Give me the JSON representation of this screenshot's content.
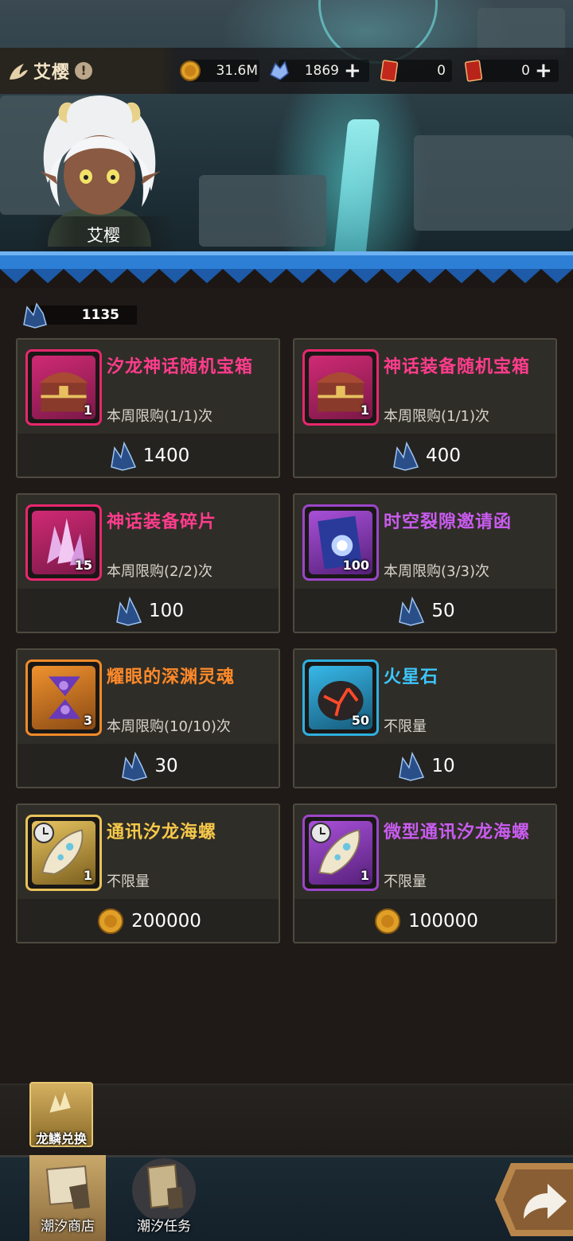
{
  "topbar": {
    "title": "艾樱",
    "info_icon": "exclamation-icon",
    "currencies": [
      {
        "name": "gold-coin-icon",
        "value": "31.6M",
        "has_plus": false
      },
      {
        "name": "crystal-icon",
        "value": "1869",
        "has_plus": true
      },
      {
        "name": "red-card-icon",
        "value": "0",
        "has_plus": false
      },
      {
        "name": "red-ticket-icon",
        "value": "0",
        "has_plus": true
      }
    ],
    "plus_label": "+"
  },
  "character": {
    "name": "艾樱"
  },
  "balance": {
    "value": "1135",
    "icon": "dragon-scale-icon"
  },
  "items": [
    {
      "name": "汐龙神话随机宝箱",
      "limit": "本周限购(1/1)次",
      "qty": "1",
      "price": "1400",
      "price_icon": "dragon-scale-icon",
      "name_color": "#ff3c8c",
      "frame": "#e8276e",
      "icon": "treasure-chest-icon",
      "timed": false
    },
    {
      "name": "神话装备随机宝箱",
      "limit": "本周限购(1/1)次",
      "qty": "1",
      "price": "400",
      "price_icon": "dragon-scale-icon",
      "name_color": "#ff3c8c",
      "frame": "#e8276e",
      "icon": "treasure-chest-icon",
      "timed": false
    },
    {
      "name": "神话装备碎片",
      "limit": "本周限购(2/2)次",
      "qty": "15",
      "price": "100",
      "price_icon": "dragon-scale-icon",
      "name_color": "#ff3c8c",
      "frame": "#e8276e",
      "icon": "crystal-shard-icon",
      "timed": false
    },
    {
      "name": "时空裂隙邀请函",
      "limit": "本周限购(3/3)次",
      "qty": "100",
      "price": "50",
      "price_icon": "dragon-scale-icon",
      "name_color": "#c95cf0",
      "frame": "#9b46c8",
      "icon": "invitation-scroll-icon",
      "timed": false
    },
    {
      "name": "耀眼的深渊灵魂",
      "limit": "本周限购(10/10)次",
      "qty": "3",
      "price": "30",
      "price_icon": "dragon-scale-icon",
      "name_color": "#ff8a2a",
      "frame": "#f08a2a",
      "icon": "abyss-soul-icon",
      "timed": false
    },
    {
      "name": "火星石",
      "limit": "不限量",
      "qty": "50",
      "price": "10",
      "price_icon": "dragon-scale-icon",
      "name_color": "#3cc6ff",
      "frame": "#2fb0e0",
      "icon": "mars-stone-icon",
      "timed": false
    },
    {
      "name": "通讯汐龙海螺",
      "limit": "不限量",
      "qty": "1",
      "price": "200000",
      "price_icon": "gold-coin-icon",
      "name_color": "#f6c84a",
      "frame": "#e8c25a",
      "icon": "conch-icon",
      "timed": true
    },
    {
      "name": "微型通讯汐龙海螺",
      "limit": "不限量",
      "qty": "1",
      "price": "100000",
      "price_icon": "gold-coin-icon",
      "name_color": "#c95cf0",
      "frame": "#9b46c8",
      "icon": "conch-icon",
      "timed": true
    }
  ],
  "exchange": {
    "label": "龙鳞兑换"
  },
  "nav": [
    {
      "label": "潮汐商店",
      "active": true
    },
    {
      "label": "潮汐任务",
      "active": false
    }
  ],
  "colors": {
    "divider_blue": "#2d7fd6",
    "background": "#1f1a17"
  }
}
